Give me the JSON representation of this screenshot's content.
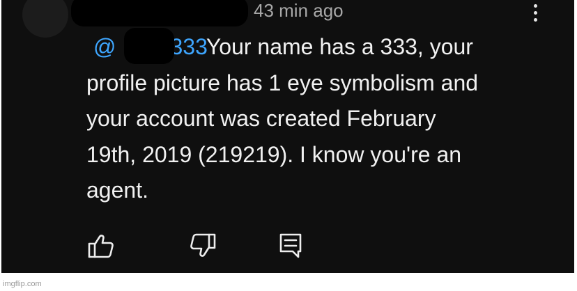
{
  "comment": {
    "timestamp": "43 min ago",
    "mention_prefix": "@",
    "mention_suffix": "333",
    "text_line1": "Your name has a 333, your",
    "text_line2": "profile picture has 1 eye symbolism and",
    "text_line3": "your account was created February",
    "text_line4": "19th, 2019 (219219). I know you're an",
    "text_line5": "agent."
  },
  "actions": {
    "like_icon": "thumbs-up-icon",
    "dislike_icon": "thumbs-down-icon",
    "reply_icon": "reply-comment-icon"
  },
  "watermark": "imgflip.com",
  "colors": {
    "background": "#0f0f0f",
    "text": "#f1f1f1",
    "mention": "#3ea6ff",
    "meta": "#a8a8a8"
  }
}
